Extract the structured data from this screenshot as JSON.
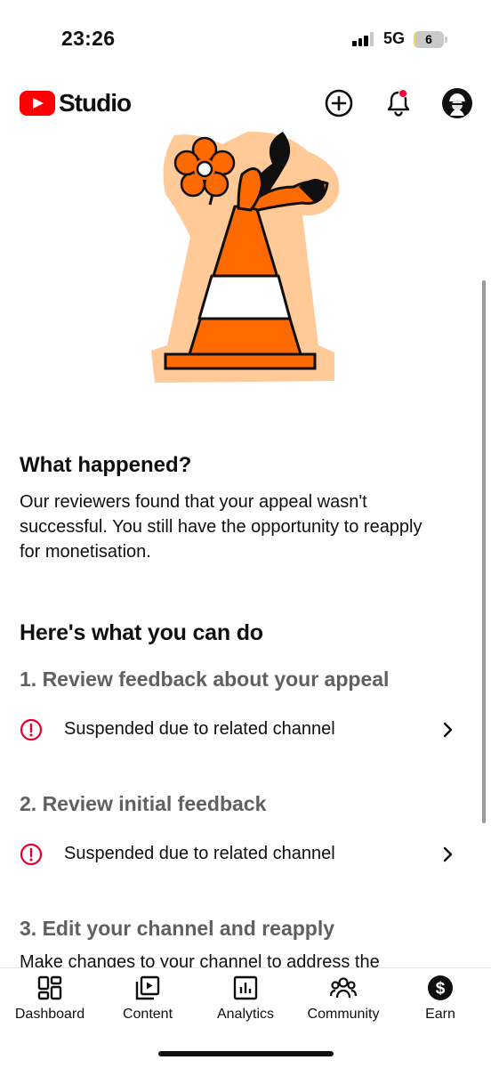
{
  "status_bar": {
    "time": "23:26",
    "network": "5G",
    "battery": "6",
    "battery_level_percent": 6
  },
  "header": {
    "brand": "Studio",
    "icons": [
      "create-icon",
      "notifications-icon",
      "avatar"
    ]
  },
  "what_happened": {
    "title": "What happened?",
    "body": "Our reviewers found that your appeal wasn't successful. You still have the opportunity to reapply for monetisation."
  },
  "actions": {
    "title": "Here's what you can do",
    "steps": [
      {
        "title": "1. Review feedback about your appeal",
        "item": "Suspended due to related channel"
      },
      {
        "title": "2. Review initial feedback",
        "item": "Suspended due to related channel"
      },
      {
        "title": "3. Edit your channel and reapply",
        "body": "Make changes to your channel to address the"
      }
    ]
  },
  "bottom_nav": [
    {
      "label": "Dashboard",
      "icon": "dashboard-icon"
    },
    {
      "label": "Content",
      "icon": "content-icon"
    },
    {
      "label": "Analytics",
      "icon": "analytics-icon"
    },
    {
      "label": "Community",
      "icon": "community-icon"
    },
    {
      "label": "Earn",
      "icon": "earn-icon"
    }
  ],
  "colors": {
    "brand_red": "#ff0000",
    "warning_red": "#e0002b",
    "cone_orange": "#ff6a00",
    "cone_halo": "#ffc998",
    "secondary_text": "#606060"
  }
}
